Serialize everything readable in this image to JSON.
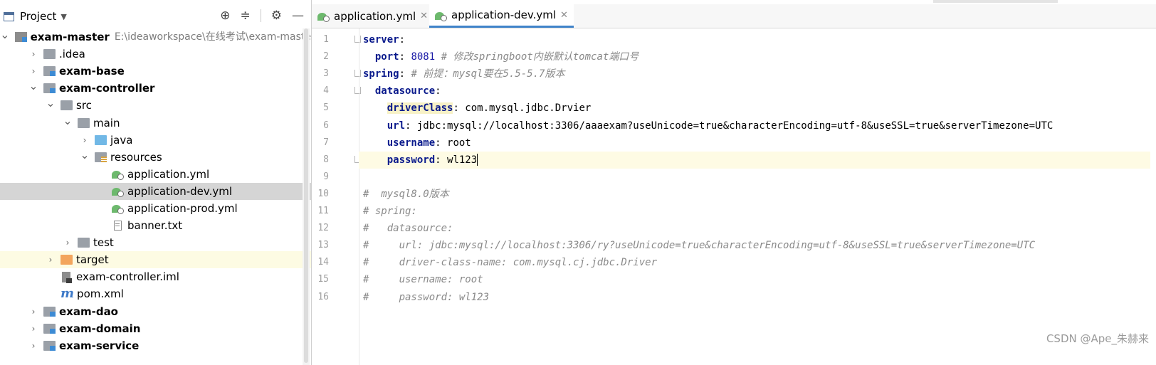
{
  "project_panel": {
    "title": "Project",
    "dropdown_glyph": "▼",
    "tools": [
      "⊕",
      "≑",
      "⚙",
      "—"
    ]
  },
  "tree": [
    {
      "depth": 0,
      "arrow": "expanded",
      "icon": "root",
      "label": "exam-master",
      "bold": true,
      "path": "E:\\ideaworkspace\\在线考试\\exam-maste"
    },
    {
      "depth": 1,
      "arrow": "collapsed",
      "icon": "folder",
      "label": ".idea"
    },
    {
      "depth": 1,
      "arrow": "collapsed",
      "icon": "module",
      "label": "exam-base",
      "bold": true
    },
    {
      "depth": 1,
      "arrow": "expanded",
      "icon": "module",
      "label": "exam-controller",
      "bold": true
    },
    {
      "depth": 2,
      "arrow": "expanded",
      "icon": "folder",
      "label": "src"
    },
    {
      "depth": 3,
      "arrow": "expanded",
      "icon": "folder",
      "label": "main"
    },
    {
      "depth": 4,
      "arrow": "collapsed",
      "icon": "blue",
      "label": "java"
    },
    {
      "depth": 4,
      "arrow": "expanded",
      "icon": "res",
      "label": "resources"
    },
    {
      "depth": 5,
      "arrow": "none",
      "icon": "yml",
      "label": "application.yml"
    },
    {
      "depth": 5,
      "arrow": "none",
      "icon": "yml",
      "label": "application-dev.yml",
      "selected": true
    },
    {
      "depth": 5,
      "arrow": "none",
      "icon": "yml",
      "label": "application-prod.yml"
    },
    {
      "depth": 5,
      "arrow": "none",
      "icon": "txt",
      "label": "banner.txt"
    },
    {
      "depth": 3,
      "arrow": "collapsed",
      "icon": "folder",
      "label": "test"
    },
    {
      "depth": 2,
      "arrow": "collapsed",
      "icon": "orange",
      "label": "target",
      "highlight": true
    },
    {
      "depth": 2,
      "arrow": "none",
      "icon": "iml",
      "label": "exam-controller.iml"
    },
    {
      "depth": 2,
      "arrow": "none",
      "icon": "pom",
      "label": "pom.xml"
    },
    {
      "depth": 1,
      "arrow": "collapsed",
      "icon": "module",
      "label": "exam-dao",
      "bold": true
    },
    {
      "depth": 1,
      "arrow": "collapsed",
      "icon": "module",
      "label": "exam-domain",
      "bold": true
    },
    {
      "depth": 1,
      "arrow": "collapsed",
      "icon": "module",
      "label": "exam-service",
      "bold": true
    }
  ],
  "pom_glyph": "m",
  "tabs": [
    {
      "label": "application.yml",
      "active": false
    },
    {
      "label": "application-dev.yml",
      "active": true
    }
  ],
  "close_glyph": "✕",
  "code": [
    {
      "n": "1",
      "indent": "",
      "segs": [
        [
          "k",
          "server"
        ],
        [
          "",
          ""
        ],
        [
          "",
          ":"
        ]
      ]
    },
    {
      "n": "2",
      "indent": "  ",
      "segs": [
        [
          "k",
          "port"
        ],
        [
          "",
          ": "
        ],
        [
          "num",
          "8081"
        ],
        [
          "cm",
          " # 修改springboot内嵌默认tomcat端口号"
        ]
      ]
    },
    {
      "n": "3",
      "indent": "",
      "segs": [
        [
          "k",
          "spring"
        ],
        [
          "",
          ": "
        ],
        [
          "cm",
          "# 前提：mysql要在5.5-5.7版本"
        ]
      ]
    },
    {
      "n": "4",
      "indent": "  ",
      "segs": [
        [
          "k",
          "datasource"
        ],
        [
          "",
          ":"
        ]
      ]
    },
    {
      "n": "5",
      "indent": "    ",
      "segs": [
        [
          "kh",
          "driverClass"
        ],
        [
          "",
          ": com.mysql.jdbc.Drvier"
        ]
      ]
    },
    {
      "n": "6",
      "indent": "    ",
      "segs": [
        [
          "k",
          "url"
        ],
        [
          "",
          ": jdbc:mysql://localhost:3306/aaaexam?useUnicode=true&characterEncoding=utf-8&useSSL=true&serverTimezone=UTC"
        ]
      ]
    },
    {
      "n": "7",
      "indent": "    ",
      "segs": [
        [
          "k",
          "username"
        ],
        [
          "",
          ": root"
        ]
      ]
    },
    {
      "n": "8",
      "indent": "    ",
      "segs": [
        [
          "k",
          "password"
        ],
        [
          "",
          ": wl123"
        ]
      ],
      "current": true
    },
    {
      "n": "9",
      "indent": "",
      "segs": []
    },
    {
      "n": "10",
      "indent": "",
      "segs": [
        [
          "cm",
          "#  mysql8.0版本"
        ]
      ]
    },
    {
      "n": "11",
      "indent": "",
      "segs": [
        [
          "cm",
          "# spring:"
        ]
      ]
    },
    {
      "n": "12",
      "indent": "",
      "segs": [
        [
          "cm",
          "#   datasource:"
        ]
      ]
    },
    {
      "n": "13",
      "indent": "",
      "segs": [
        [
          "cm",
          "#     url: jdbc:mysql://localhost:3306/ry?useUnicode=true&characterEncoding=utf-8&useSSL=true&serverTimezone=UTC"
        ]
      ]
    },
    {
      "n": "14",
      "indent": "",
      "segs": [
        [
          "cm",
          "#     driver-class-name: com.mysql.cj.jdbc.Driver"
        ]
      ]
    },
    {
      "n": "15",
      "indent": "",
      "segs": [
        [
          "cm",
          "#     username: root"
        ]
      ]
    },
    {
      "n": "16",
      "indent": "",
      "segs": [
        [
          "cm",
          "#     password: wl123"
        ]
      ]
    }
  ],
  "watermark": "CSDN @Ape_朱赫来"
}
